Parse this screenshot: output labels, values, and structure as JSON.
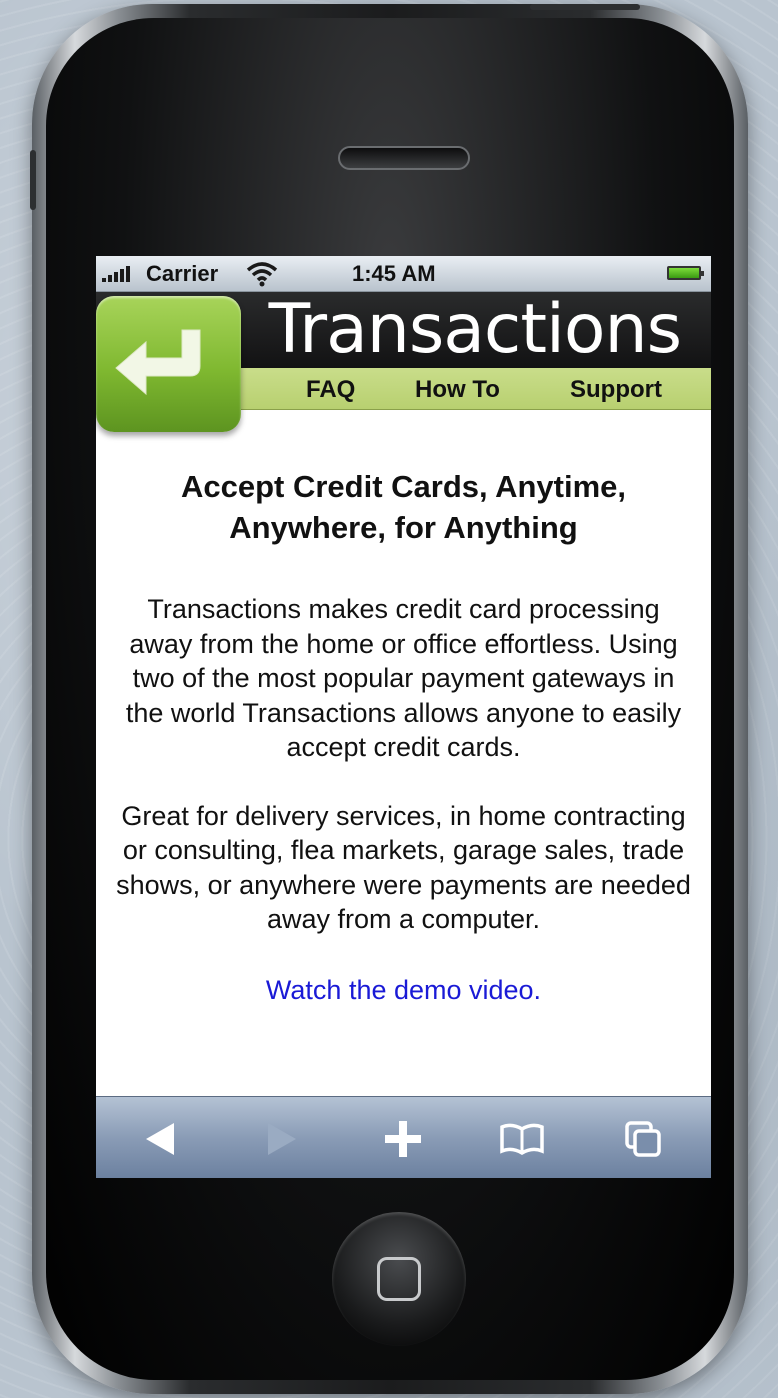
{
  "status_bar": {
    "carrier": "Carrier",
    "time": "1:45 AM"
  },
  "app": {
    "title": "Transactions",
    "accent_color": "#c2d77c",
    "back_icon": "return-arrow-icon"
  },
  "nav": {
    "items": [
      {
        "label": "FAQ"
      },
      {
        "label": "How To"
      },
      {
        "label": "Support"
      }
    ]
  },
  "main": {
    "headline": "Accept Credit Cards, Anytime, Anywhere, for Anything",
    "paragraph1": "Transactions makes credit card processing away from the home or office effortless. Using two of the most popular payment gateways in the world Transactions allows anyone to easily accept credit cards.",
    "paragraph2": "Great for delivery services, in home contracting or consulting, flea markets, garage sales, trade shows, or anywhere were payments are needed away from a computer.",
    "demo_link": "Watch the demo video.",
    "link_color": "#1a1ad6"
  },
  "toolbar": {
    "buttons": [
      "back-arrow-icon",
      "forward-arrow-icon",
      "plus-icon",
      "bookmarks-icon",
      "pages-icon"
    ]
  }
}
